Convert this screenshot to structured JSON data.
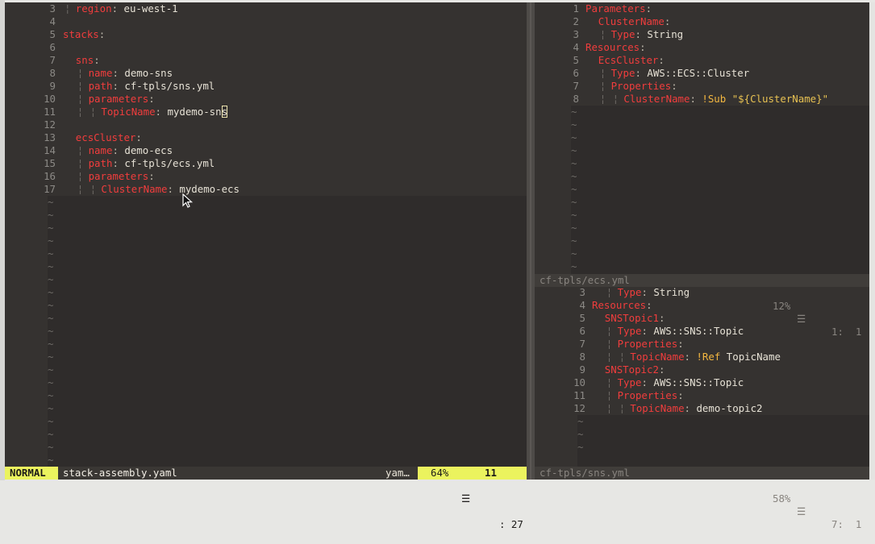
{
  "left_pane": {
    "lines": [
      {
        "n": "3",
        "indent": 1,
        "parts": [
          {
            "t": "region",
            "c": "key"
          },
          {
            "t": ":",
            "c": "colon"
          },
          {
            "t": " eu-west-1",
            "c": "val"
          }
        ],
        "guides": 1
      },
      {
        "n": "4",
        "indent": 0,
        "parts": [],
        "guides": 0
      },
      {
        "n": "5",
        "indent": 0,
        "parts": [
          {
            "t": "stacks",
            "c": "key"
          },
          {
            "t": ":",
            "c": "colon"
          }
        ],
        "guides": 0
      },
      {
        "n": "6",
        "indent": 0,
        "parts": [],
        "guides": 0
      },
      {
        "n": "7",
        "indent": 1,
        "parts": [
          {
            "t": "sns",
            "c": "key"
          },
          {
            "t": ":",
            "c": "colon"
          }
        ],
        "guides": 0
      },
      {
        "n": "8",
        "indent": 2,
        "parts": [
          {
            "t": "name",
            "c": "key"
          },
          {
            "t": ":",
            "c": "colon"
          },
          {
            "t": " demo-sns",
            "c": "val"
          }
        ],
        "guides": 1
      },
      {
        "n": "9",
        "indent": 2,
        "parts": [
          {
            "t": "path",
            "c": "key"
          },
          {
            "t": ":",
            "c": "colon"
          },
          {
            "t": " cf-tpls/sns.yml",
            "c": "val"
          }
        ],
        "guides": 1
      },
      {
        "n": "10",
        "indent": 2,
        "parts": [
          {
            "t": "parameters",
            "c": "key"
          },
          {
            "t": ":",
            "c": "colon"
          }
        ],
        "guides": 1
      },
      {
        "n": "11",
        "indent": 3,
        "parts": [
          {
            "t": "TopicName",
            "c": "key"
          },
          {
            "t": ":",
            "c": "colon"
          },
          {
            "t": " mydemo-sn",
            "c": "val"
          },
          {
            "t": "s",
            "c": "val cursorbox"
          }
        ],
        "guides": 2
      },
      {
        "n": "12",
        "indent": 0,
        "parts": [],
        "guides": 0
      },
      {
        "n": "13",
        "indent": 1,
        "parts": [
          {
            "t": "ecsCluster",
            "c": "key"
          },
          {
            "t": ":",
            "c": "colon"
          }
        ],
        "guides": 0
      },
      {
        "n": "14",
        "indent": 2,
        "parts": [
          {
            "t": "name",
            "c": "key"
          },
          {
            "t": ":",
            "c": "colon"
          },
          {
            "t": " demo-ecs",
            "c": "val"
          }
        ],
        "guides": 1
      },
      {
        "n": "15",
        "indent": 2,
        "parts": [
          {
            "t": "path",
            "c": "key"
          },
          {
            "t": ":",
            "c": "colon"
          },
          {
            "t": " cf-tpls/ecs.yml",
            "c": "val"
          }
        ],
        "guides": 1
      },
      {
        "n": "16",
        "indent": 2,
        "parts": [
          {
            "t": "parameters",
            "c": "key"
          },
          {
            "t": ":",
            "c": "colon"
          }
        ],
        "guides": 1
      },
      {
        "n": "17",
        "indent": 3,
        "parts": [
          {
            "t": "ClusterName",
            "c": "key"
          },
          {
            "t": ":",
            "c": "colon"
          },
          {
            "t": " mydemo-ecs",
            "c": "val"
          }
        ],
        "guides": 2
      }
    ],
    "tilde_count": 21,
    "tilde": "~"
  },
  "right_top_pane": {
    "lines": [
      {
        "n": "1",
        "indent": 0,
        "parts": [
          {
            "t": "Parameters",
            "c": "key"
          },
          {
            "t": ":",
            "c": "colon"
          }
        ],
        "guides": 0
      },
      {
        "n": "2",
        "indent": 1,
        "parts": [
          {
            "t": "ClusterName",
            "c": "key"
          },
          {
            "t": ":",
            "c": "colon"
          }
        ],
        "guides": 0
      },
      {
        "n": "3",
        "indent": 2,
        "parts": [
          {
            "t": "Type",
            "c": "key"
          },
          {
            "t": ":",
            "c": "colon"
          },
          {
            "t": " String",
            "c": "val"
          }
        ],
        "guides": 1
      },
      {
        "n": "4",
        "indent": 0,
        "parts": [
          {
            "t": "Resources",
            "c": "key"
          },
          {
            "t": ":",
            "c": "colon"
          }
        ],
        "guides": 0
      },
      {
        "n": "5",
        "indent": 1,
        "parts": [
          {
            "t": "EcsCluster",
            "c": "key"
          },
          {
            "t": ":",
            "c": "colon"
          }
        ],
        "guides": 0
      },
      {
        "n": "6",
        "indent": 2,
        "parts": [
          {
            "t": "Type",
            "c": "key"
          },
          {
            "t": ":",
            "c": "colon"
          },
          {
            "t": " AWS::ECS::Cluster",
            "c": "val"
          }
        ],
        "guides": 1
      },
      {
        "n": "7",
        "indent": 2,
        "parts": [
          {
            "t": "Properties",
            "c": "key"
          },
          {
            "t": ":",
            "c": "colon"
          }
        ],
        "guides": 1
      },
      {
        "n": "8",
        "indent": 3,
        "parts": [
          {
            "t": "ClusterName",
            "c": "key"
          },
          {
            "t": ":",
            "c": "colon"
          },
          {
            "t": " ",
            "c": "val"
          },
          {
            "t": "!Sub",
            "c": "tag"
          },
          {
            "t": " \"${ClusterName}\"",
            "c": "str"
          }
        ],
        "guides": 2
      }
    ],
    "tilde_count": 13,
    "status": {
      "file": "cf-tpls/ecs.yml",
      "percent": "12%",
      "menu_icon": "☰",
      "position": "1:  1"
    }
  },
  "right_bottom_pane": {
    "lines": [
      {
        "n": "3",
        "indent": 2,
        "parts": [
          {
            "t": "Type",
            "c": "key"
          },
          {
            "t": ":",
            "c": "colon"
          },
          {
            "t": " String",
            "c": "val"
          }
        ],
        "guides": 1
      },
      {
        "n": "4",
        "indent": 0,
        "parts": [
          {
            "t": "Resources",
            "c": "key"
          },
          {
            "t": ":",
            "c": "colon"
          }
        ],
        "guides": 0
      },
      {
        "n": "5",
        "indent": 1,
        "parts": [
          {
            "t": "SNSTopic1",
            "c": "key"
          },
          {
            "t": ":",
            "c": "colon"
          }
        ],
        "guides": 0
      },
      {
        "n": "6",
        "indent": 2,
        "parts": [
          {
            "t": "Type",
            "c": "key"
          },
          {
            "t": ":",
            "c": "colon"
          },
          {
            "t": " AWS::SNS::Topic",
            "c": "val"
          }
        ],
        "guides": 1
      },
      {
        "n": "7",
        "indent": 2,
        "parts": [
          {
            "t": "Properties",
            "c": "key"
          },
          {
            "t": ":",
            "c": "colon"
          }
        ],
        "guides": 1
      },
      {
        "n": "8",
        "indent": 3,
        "parts": [
          {
            "t": "TopicName",
            "c": "key"
          },
          {
            "t": ":",
            "c": "colon"
          },
          {
            "t": " ",
            "c": "val"
          },
          {
            "t": "!Ref",
            "c": "ref"
          },
          {
            "t": " TopicName",
            "c": "val"
          }
        ],
        "guides": 2
      },
      {
        "n": "9",
        "indent": 1,
        "parts": [
          {
            "t": "SNSTopic2",
            "c": "key"
          },
          {
            "t": ":",
            "c": "colon"
          }
        ],
        "guides": 0
      },
      {
        "n": "10",
        "indent": 2,
        "parts": [
          {
            "t": "Type",
            "c": "key"
          },
          {
            "t": ":",
            "c": "colon"
          },
          {
            "t": " AWS::SNS::Topic",
            "c": "val"
          }
        ],
        "guides": 1
      },
      {
        "n": "11",
        "indent": 2,
        "parts": [
          {
            "t": "Properties",
            "c": "key"
          },
          {
            "t": ":",
            "c": "colon"
          }
        ],
        "guides": 1
      },
      {
        "n": "12",
        "indent": 3,
        "parts": [
          {
            "t": "TopicName",
            "c": "key"
          },
          {
            "t": ":",
            "c": "colon"
          },
          {
            "t": " demo-topic2",
            "c": "val"
          }
        ],
        "guides": 2
      }
    ],
    "tilde_count": 3,
    "status": {
      "file": "cf-tpls/sns.yml",
      "percent": "58%",
      "menu_icon": "☰",
      "position": "7:  1"
    }
  },
  "status_left": {
    "mode": "NORMAL",
    "file": "stack-assembly.yaml",
    "filetype": "yam…",
    "percent": "64%",
    "menu_icon": "☰",
    "line": "11",
    "col": ": 27"
  },
  "colors": {
    "key": "#f13d3d",
    "mode_bg": "#ebf35e",
    "editor_bg": "#353230"
  },
  "icons": {
    "cursor": "mouse-pointer-icon",
    "menu": "hamburger-icon"
  }
}
